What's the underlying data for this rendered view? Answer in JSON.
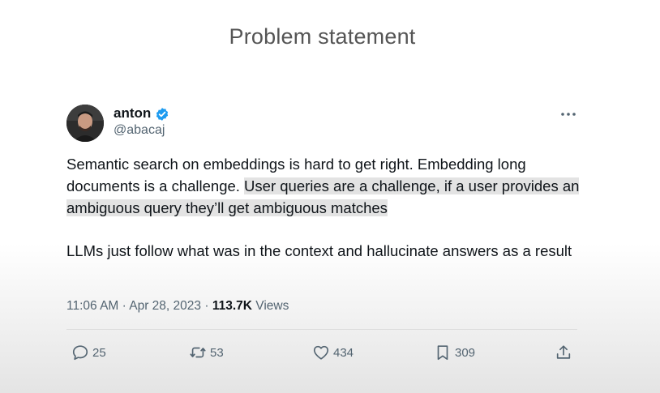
{
  "slide": {
    "title": "Problem statement"
  },
  "tweet": {
    "author_name": "anton",
    "author_handle": "@abacaj",
    "paragraph1_plain": "Semantic search on embeddings is hard to get right. Embedding long documents is a challenge.",
    "paragraph1_highlight": "User queries are a challenge, if a user provides an ambiguous query they’ll get ambiguous matches",
    "paragraph2": "LLMs just follow what was in the context and hallucinate answers as a result",
    "timestamp": "11:06 AM · Apr 28, 2023 ·",
    "views_count": "113.7K",
    "views_label": "Views",
    "icons": {
      "verified": "verified-badge-icon",
      "more": "more-options-icon"
    },
    "colors": {
      "verified_blue": "#1d9bf0",
      "highlight": "#e3e3e3",
      "secondary_text": "#536471"
    }
  },
  "actions": {
    "replies": "25",
    "retweets": "53",
    "likes": "434",
    "bookmarks": "309"
  }
}
